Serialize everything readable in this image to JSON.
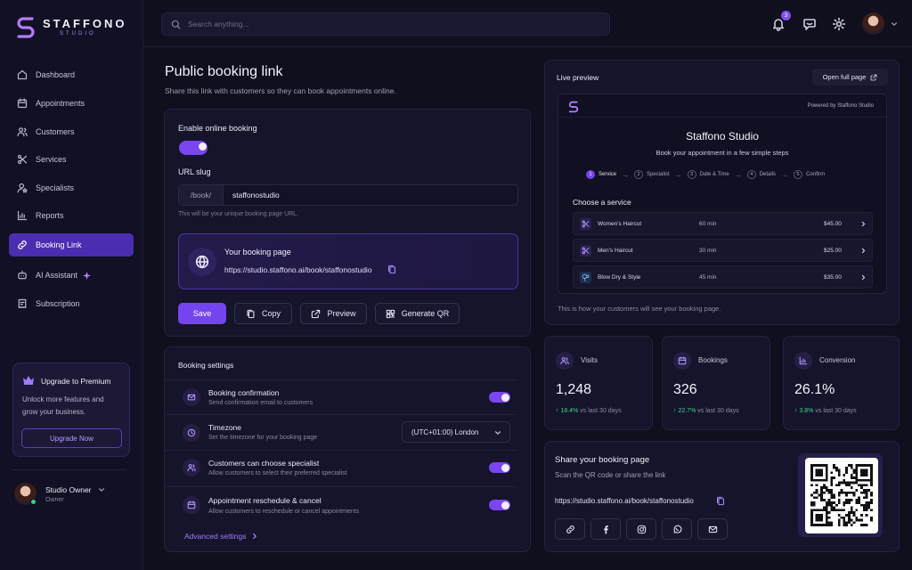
{
  "app": {
    "logo_word": "STAFFONO",
    "logo_sub": "STUDIO"
  },
  "sidebar": {
    "items": [
      {
        "label": "Dashboard",
        "icon": "dashboard-icon"
      },
      {
        "label": "Appointments",
        "icon": "calendar-icon"
      },
      {
        "label": "Customers",
        "icon": "users-icon"
      },
      {
        "label": "Services",
        "icon": "scissors-icon"
      },
      {
        "label": "Specialists",
        "icon": "user-star-icon"
      },
      {
        "label": "Reports",
        "icon": "chart-icon"
      },
      {
        "label": "Booking Link",
        "icon": "link-icon",
        "active": true
      },
      {
        "label": "AI Assistant",
        "icon": "robot-icon"
      },
      {
        "label": "Subscription",
        "icon": "receipt-icon"
      }
    ],
    "upgrade": {
      "title": "Upgrade to Premium",
      "text_line1": "Unlock more features and",
      "text_line2": "grow your business.",
      "button": "Upgrade Now"
    },
    "user": {
      "name": "Studio Owner",
      "role": "Owner"
    }
  },
  "topbar": {
    "search_placeholder": "Search anything...",
    "notification_count": "3"
  },
  "page": {
    "title": "Public booking link",
    "subtitle": "Share this link with customers so they can book appointments online."
  },
  "booking_form": {
    "enable_label": "Enable online booking",
    "slug_label": "URL slug",
    "slug_prefix": "/book/",
    "slug_value": "staffonostudio",
    "slug_hint": "This will be your unique booking page URL.",
    "card_title": "Your booking page",
    "card_url": "https://studio.staffono.ai/book/staffonostudio",
    "btn_save": "Save",
    "btn_copy": "Copy",
    "btn_preview": "Preview",
    "btn_qr": "Generate QR"
  },
  "settings": {
    "title": "Booking settings",
    "rows": [
      {
        "title": "Booking confirmation",
        "desc": "Send confirmation email to customers"
      },
      {
        "title": "Timezone",
        "desc": "Set the timezone for your booking page",
        "value": "(UTC+01:00) London"
      },
      {
        "title": "Customers can choose specialist",
        "desc": "Allow customers to select their preferred specialist"
      },
      {
        "title": "Appointment reschedule & cancel",
        "desc": "Allow customers to reschedule or cancel appointments"
      }
    ],
    "advanced": "Advanced settings"
  },
  "preview": {
    "title": "Live preview",
    "open_btn": "Open full page",
    "powered": "Powered by Staffono Studio",
    "studio_name": "Staffono Studio",
    "tagline": "Book your appointment in a few simple steps",
    "steps": [
      {
        "n": "1",
        "label": "Service"
      },
      {
        "n": "2",
        "label": "Specialist"
      },
      {
        "n": "3",
        "label": "Date & Time"
      },
      {
        "n": "4",
        "label": "Details"
      },
      {
        "n": "5",
        "label": "Confirm"
      }
    ],
    "choose": "Choose a service",
    "services": [
      {
        "name": "Women's Haircut",
        "duration": "60 min",
        "price": "$45.00"
      },
      {
        "name": "Men's Haircut",
        "duration": "30 min",
        "price": "$25.00"
      },
      {
        "name": "Blow Dry & Style",
        "duration": "45 min",
        "price": "$35.00"
      }
    ],
    "note": "This is how your customers will see your booking page."
  },
  "stats": [
    {
      "label": "Visits",
      "value": "1,248",
      "change": "18.4%",
      "suffix": "vs last 30 days"
    },
    {
      "label": "Bookings",
      "value": "326",
      "change": "22.7%",
      "suffix": "vs last 30 days"
    },
    {
      "label": "Conversion",
      "value": "26.1%",
      "change": "3.8%",
      "suffix": "vs last 30 days"
    }
  ],
  "share": {
    "title": "Share your booking page",
    "subtitle": "Scan the QR code or share the link",
    "url": "https://studio.staffono.ai/book/staffonostudio"
  },
  "colors": {
    "accent": "#7445ee",
    "background": "#0f0f1e",
    "panel": "#15142a",
    "positive": "#3ad48f"
  }
}
